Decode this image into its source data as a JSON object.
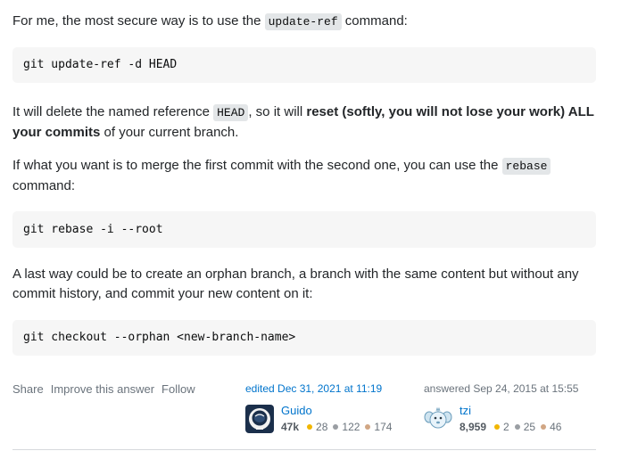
{
  "para1": {
    "before": "For me, the most secure way is to use the ",
    "code": "update-ref",
    "after": " command:"
  },
  "code1": "git update-ref -d HEAD",
  "para2": {
    "before": "It will delete the named reference ",
    "code": "HEAD",
    "middle": ", so it will ",
    "bold": "reset (softly, you will not lose your work) ALL your commits",
    "after": " of your current branch."
  },
  "para3": {
    "before": "If what you want is to merge the first commit with the second one, you can use the ",
    "code": "rebase",
    "after": " command:"
  },
  "code2": "git rebase -i --root",
  "para4": "A last way could be to create an orphan branch, a branch with the same content but without any commit history, and commit your new content on it:",
  "code3": "git checkout --orphan <new-branch-name>",
  "menu": {
    "share": "Share",
    "improve": "Improve this answer",
    "follow": "Follow"
  },
  "editor": {
    "action": "edited Dec 31, 2021 at 11:19",
    "name": "Guido",
    "reputation": "47k",
    "gold": "28",
    "silver": "122",
    "bronze": "174"
  },
  "author": {
    "action": "answered Sep 24, 2015 at 15:55",
    "name": "tzi",
    "reputation": "8,959",
    "gold": "2",
    "silver": "25",
    "bronze": "46"
  },
  "colors": {
    "link": "#0074cc",
    "gold": "#f1b600",
    "silver": "#9a9ea3",
    "bronze": "#d1a684"
  }
}
